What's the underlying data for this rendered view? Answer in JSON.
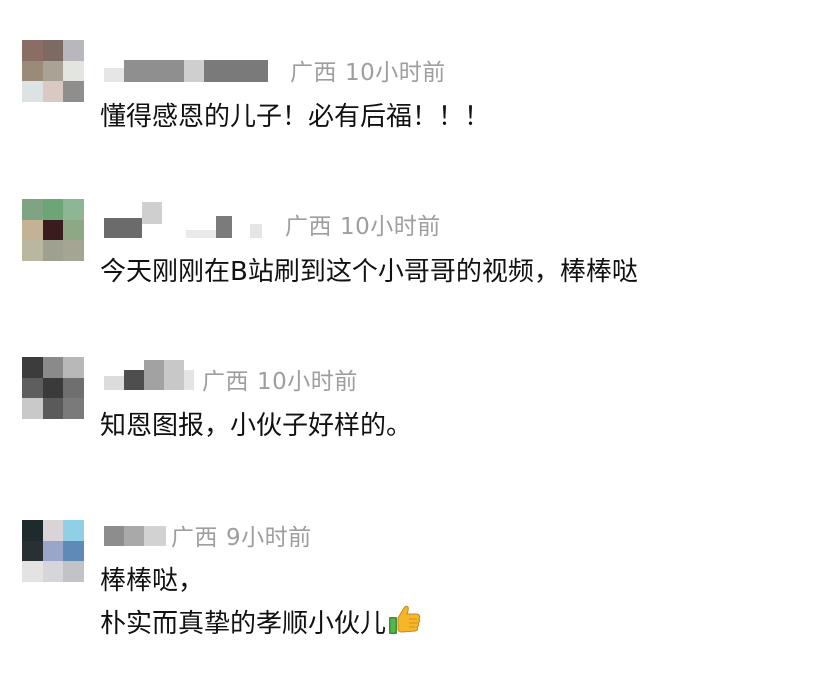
{
  "comments": [
    {
      "location": "广西",
      "time": "10小时前",
      "lines": [
        "懂得感恩的儿子！必有后福！！！"
      ],
      "avatar_colors": [
        "#8a6e66",
        "#7d6a63",
        "#b9b7bd",
        "#9a8b78",
        "#a9a396",
        "#e3e5e0",
        "#dde3e5",
        "#d9c8c4",
        "#8f8e8c"
      ]
    },
    {
      "location": "广西",
      "time": "10小时前",
      "lines": [
        "今天刚刚在B站刷到这个小哥哥的视频，棒棒哒"
      ],
      "avatar_colors": [
        "#7fa383",
        "#6ea576",
        "#8eb594",
        "#c4b294",
        "#3a1c1e",
        "#8ea784",
        "#b9b79f",
        "#9fa08f",
        "#a4a693"
      ]
    },
    {
      "location": "广西",
      "time": "10小时前",
      "lines": [
        "知恩图报，小伙子好样的。"
      ],
      "avatar_colors": [
        "#3c3c3c",
        "#8a8a8a",
        "#b8b8b8",
        "#5e5e5e",
        "#3a3a3a",
        "#6f6f6f",
        "#c9c9c9",
        "#5a5a5a",
        "#7a7a7a"
      ]
    },
    {
      "location": "广西",
      "time": "9小时前",
      "lines": [
        "棒棒哒，",
        "朴实而真挚的孝顺小伙儿"
      ],
      "avatar_colors": [
        "#1f2a2c",
        "#d8d4d8",
        "#8fd0e6",
        "#293034",
        "#9aa6c9",
        "#5f89b6",
        "#e4e2e2",
        "#d6d6da",
        "#c2c3c7"
      ]
    }
  ],
  "icons": {
    "thumbs_up": "thumbs-up-emoji"
  }
}
